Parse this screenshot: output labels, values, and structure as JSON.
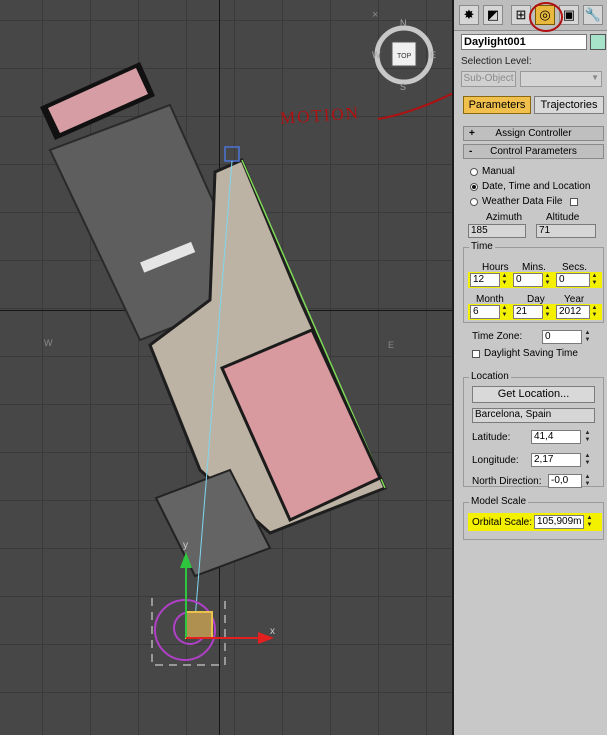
{
  "viewport": {
    "close_glyph": "×",
    "viewcube_label": "TOP",
    "compass": {
      "north": "N",
      "south": "S",
      "east": "E",
      "west": "W"
    },
    "compass_ring": {
      "west": "W",
      "east": "E"
    },
    "annotation": "MOTION",
    "gizmo_axes": {
      "x": "x",
      "y": "y"
    }
  },
  "panel": {
    "tabs": [
      {
        "icon": "create-icon",
        "glyph": "✸"
      },
      {
        "icon": "modify-icon",
        "glyph": "◩"
      },
      {
        "icon": "hierarchy-icon",
        "glyph": "⊞"
      },
      {
        "icon": "motion-icon",
        "glyph": "◎"
      },
      {
        "icon": "display-icon",
        "glyph": "▣"
      },
      {
        "icon": "utilities-icon",
        "glyph": "🔧"
      }
    ],
    "object_name": "Daylight001",
    "selection_level_label": "Selection Level:",
    "sub_object_button": "Sub-Object",
    "parameters_button": "Parameters",
    "trajectories_button": "Trajectories",
    "assign_controller_rollout": {
      "sign": "+",
      "title": "Assign Controller"
    },
    "control_parameters_rollout": {
      "sign": "-",
      "title": "Control Parameters"
    },
    "modes": {
      "manual": "Manual",
      "date_time_location": "Date, Time and Location",
      "weather_data_file": "Weather Data File"
    },
    "azimuth_label": "Azimuth",
    "altitude_label": "Altitude",
    "azimuth_value": "185",
    "altitude_value": "71",
    "time_group": "Time",
    "hours_label": "Hours",
    "mins_label": "Mins.",
    "secs_label": "Secs.",
    "hours": "12",
    "mins": "0",
    "secs": "0",
    "month_label": "Month",
    "day_label": "Day",
    "year_label": "Year",
    "month": "6",
    "day": "21",
    "year": "2012",
    "time_zone_label": "Time Zone:",
    "time_zone": "0",
    "daylight_saving": "Daylight Saving Time",
    "location_group": "Location",
    "get_location_button": "Get Location...",
    "location_name": "Barcelona, Spain",
    "latitude_label": "Latitude:",
    "latitude": "41,4",
    "longitude_label": "Longitude:",
    "longitude": "2,17",
    "north_direction_label": "North Direction:",
    "north_direction": "-0,0",
    "model_scale_group": "Model Scale",
    "orbital_scale_label": "Orbital Scale:",
    "orbital_scale": "105,909m"
  },
  "colors": {
    "highlight": "#f3f000",
    "active_tab": "#e8b93e",
    "annotation": "#b01010"
  }
}
